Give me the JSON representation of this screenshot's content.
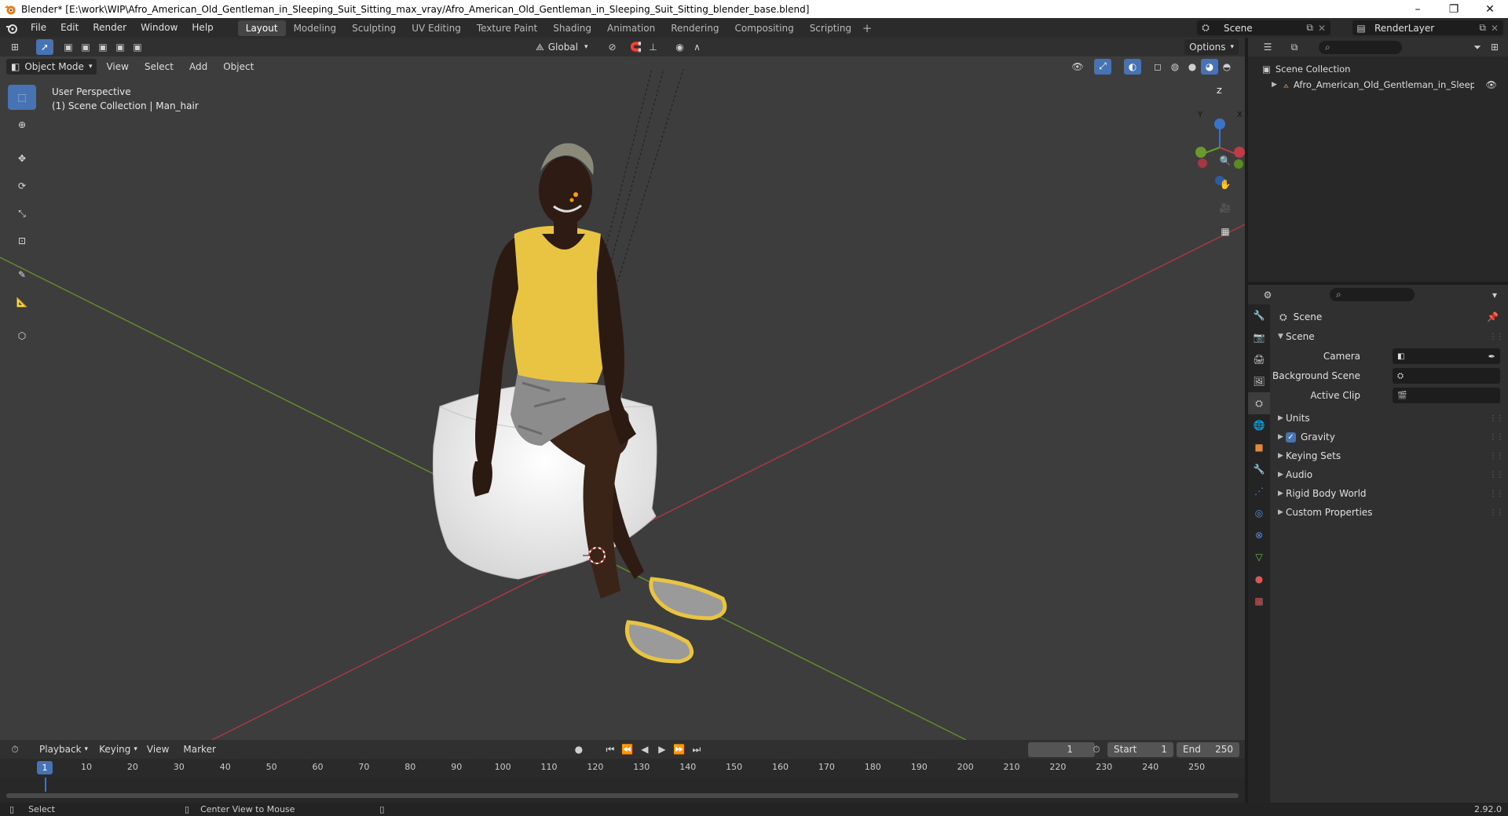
{
  "window": {
    "title": "Blender* [E:\\work\\WIP\\Afro_American_Old_Gentleman_in_Sleeping_Suit_Sitting_max_vray/Afro_American_Old_Gentleman_in_Sleeping_Suit_Sitting_blender_base.blend]",
    "minimize": "–",
    "maximize": "❐",
    "close": "✕"
  },
  "menu": [
    "File",
    "Edit",
    "Render",
    "Window",
    "Help"
  ],
  "workspaces": [
    "Layout",
    "Modeling",
    "Sculpting",
    "UV Editing",
    "Texture Paint",
    "Shading",
    "Animation",
    "Rendering",
    "Compositing",
    "Scripting"
  ],
  "active_workspace": "Layout",
  "scene_name": "Scene",
  "render_layer": "RenderLayer",
  "viewport": {
    "transform_orientation": "Global",
    "options_label": "Options",
    "mode": "Object Mode",
    "header_menus": [
      "View",
      "Select",
      "Add",
      "Object"
    ],
    "perspective_label": "User Perspective",
    "collection_label": "(1) Scene Collection | Man_hair"
  },
  "gizmo": {
    "x": "X",
    "y": "Y",
    "z": "Z"
  },
  "timeline": {
    "menus": [
      "Playback",
      "Keying",
      "View",
      "Marker"
    ],
    "current_frame": "1",
    "start_label": "Start",
    "start": "1",
    "end_label": "End",
    "end": "250",
    "ruler": [
      "1",
      "10",
      "20",
      "30",
      "40",
      "50",
      "60",
      "70",
      "80",
      "90",
      "100",
      "110",
      "120",
      "130",
      "140",
      "150",
      "160",
      "170",
      "180",
      "190",
      "200",
      "210",
      "220",
      "230",
      "240",
      "250"
    ]
  },
  "statusbar": {
    "select": "Select",
    "center_view": "Center View to Mouse",
    "version": "2.92.0"
  },
  "outliner": {
    "root": "Scene Collection",
    "items": [
      "Afro_American_Old_Gentleman_in_Sleeping_"
    ]
  },
  "properties": {
    "context": "Scene",
    "panel_title": "Scene",
    "camera_label": "Camera",
    "background_scene_label": "Background Scene",
    "active_clip_label": "Active Clip",
    "collapsed_panels": [
      "Units",
      "Gravity",
      "Keying Sets",
      "Audio",
      "Rigid Body World",
      "Custom Properties"
    ]
  },
  "colors": {
    "accent": "#4772b3",
    "x_axis": "#c03a4a",
    "y_axis": "#6a9a2a",
    "shirt": "#e8c442",
    "skin": "#2e1c14"
  }
}
